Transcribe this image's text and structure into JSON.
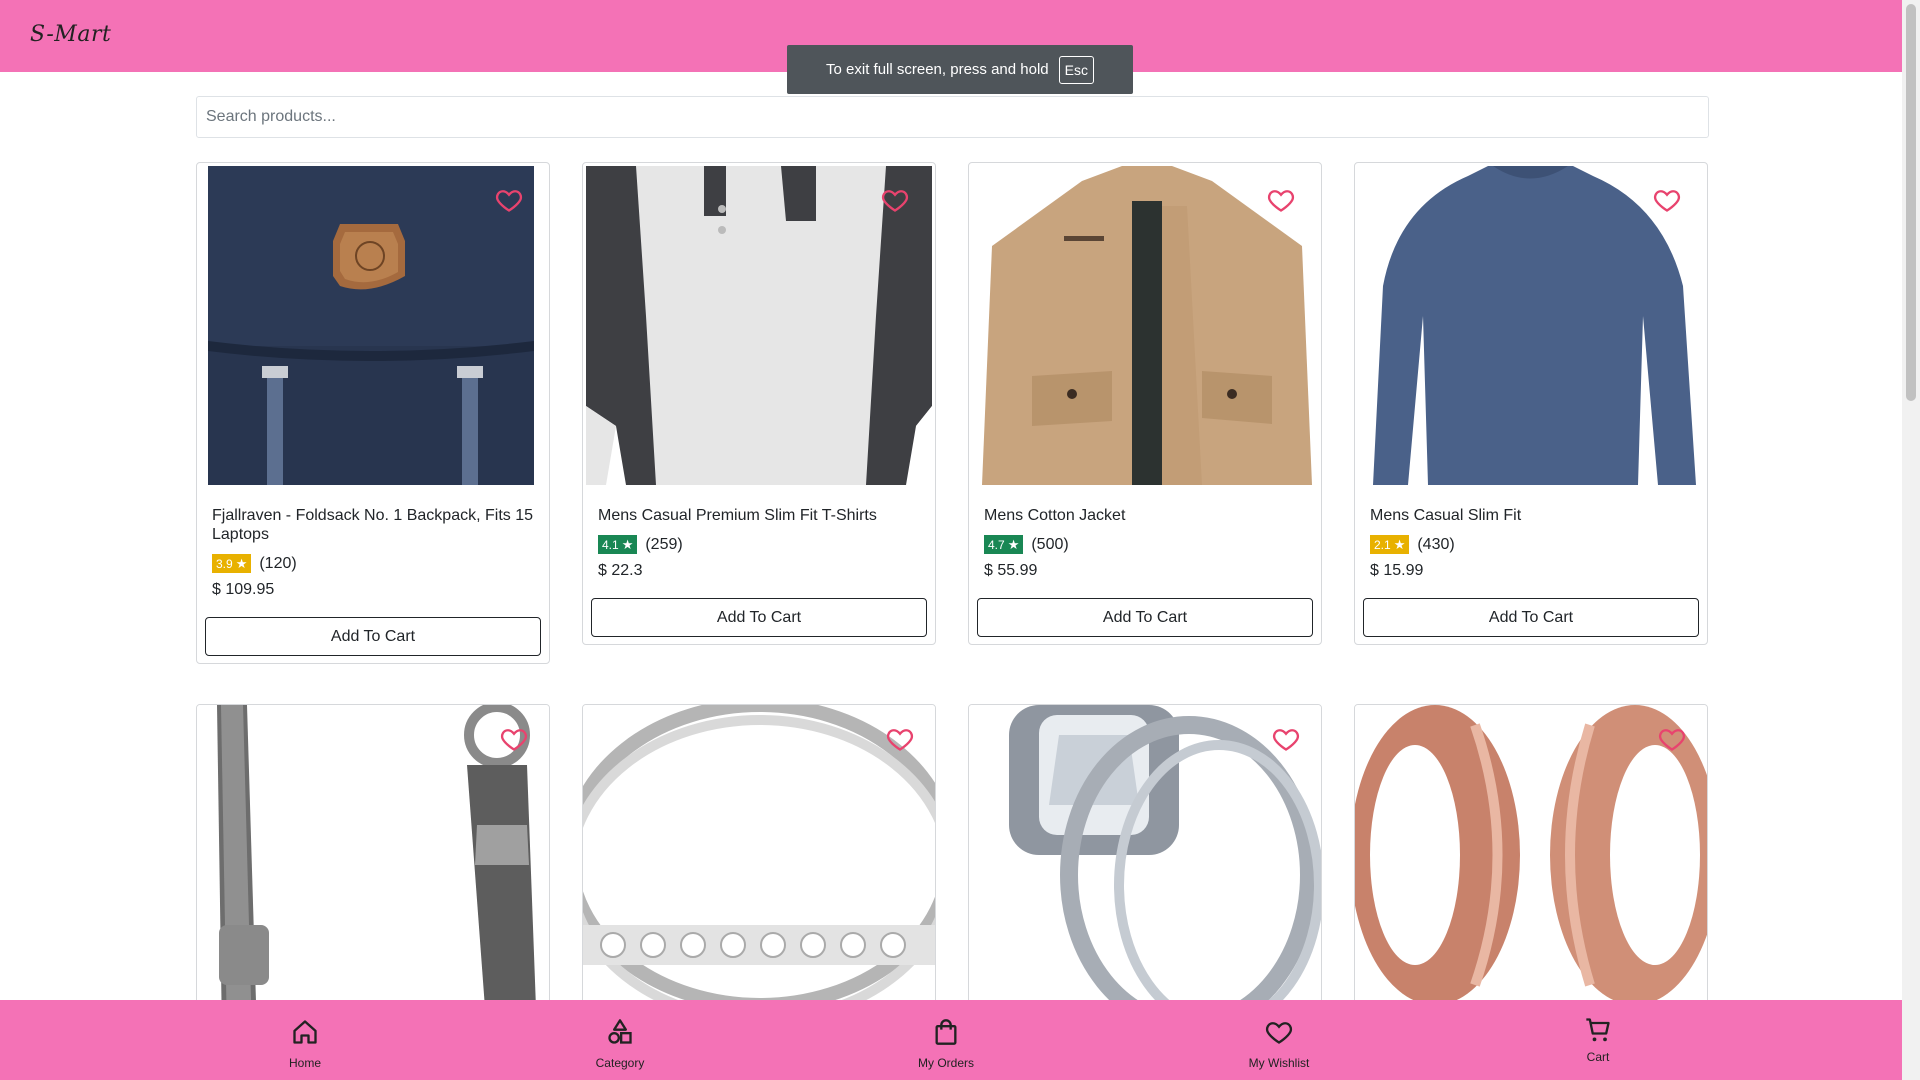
{
  "brand": "S-Mart",
  "fullscreen_notice": {
    "text": "To exit full screen, press and hold",
    "key": "Esc"
  },
  "search": {
    "placeholder": "Search products..."
  },
  "products": [
    {
      "title": "Fjallraven - Foldsack No. 1 Backpack, Fits 15 Laptops",
      "rating": "3.9",
      "rating_color": "#e8b100",
      "count": "(120)",
      "price": "$ 109.95",
      "button": "Add To Cart"
    },
    {
      "title": "Mens Casual Premium Slim Fit T-Shirts",
      "rating": "4.1",
      "rating_color": "#198754",
      "count": "(259)",
      "price": "$ 22.3",
      "button": "Add To Cart"
    },
    {
      "title": "Mens Cotton Jacket",
      "rating": "4.7",
      "rating_color": "#198754",
      "count": "(500)",
      "price": "$ 55.99",
      "button": "Add To Cart"
    },
    {
      "title": "Mens Casual Slim Fit",
      "rating": "2.1",
      "rating_color": "#e8b100",
      "count": "(430)",
      "price": "$ 15.99",
      "button": "Add To Cart"
    }
  ],
  "bottom_nav": [
    {
      "label": "Home",
      "icon": "home-icon"
    },
    {
      "label": "Category",
      "icon": "category-icon"
    },
    {
      "label": "My Orders",
      "icon": "shopping-bag-icon"
    },
    {
      "label": "My Wishlist",
      "icon": "heart-icon"
    },
    {
      "label": "Cart",
      "icon": "cart-icon"
    }
  ],
  "colors": {
    "accent": "#f472b6",
    "heart": "#e8436e",
    "badge_good": "#198754",
    "badge_mid": "#e8b100"
  }
}
